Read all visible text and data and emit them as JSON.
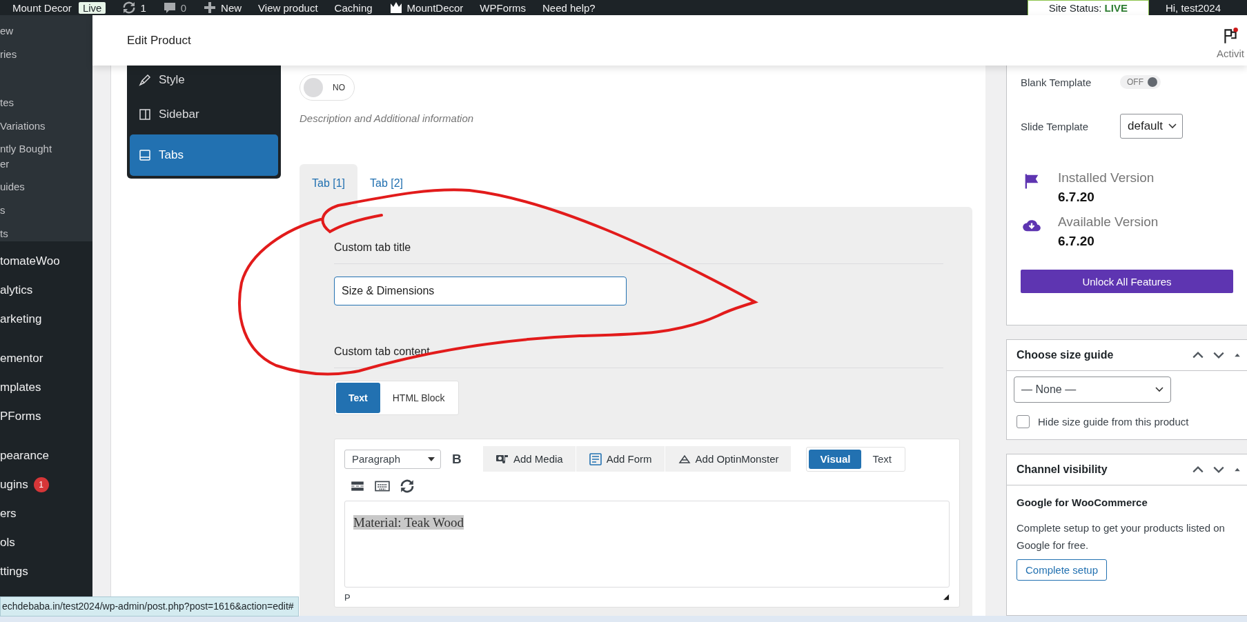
{
  "admin_bar": {
    "items": [
      {
        "kind": "text",
        "label": "Mount Decor"
      },
      {
        "kind": "badge",
        "label": "Live"
      },
      {
        "kind": "updates",
        "label": "1"
      },
      {
        "kind": "comments",
        "label": "0"
      },
      {
        "kind": "new",
        "label": "New"
      },
      {
        "kind": "text",
        "label": "View product"
      },
      {
        "kind": "text",
        "label": "Caching"
      },
      {
        "kind": "logo",
        "label": "MountDecor"
      },
      {
        "kind": "text",
        "label": "WPForms"
      },
      {
        "kind": "text",
        "label": "Need help?"
      }
    ],
    "site_status": {
      "label": "Site Status:",
      "value": "LIVE"
    },
    "greeting": "Hi, test2024"
  },
  "admin_menu": {
    "submenu": [
      {
        "lines": [
          "ew"
        ]
      },
      {
        "lines": [
          "ries"
        ]
      },
      {
        "lines": [
          "tes"
        ]
      },
      {
        "lines": [
          "Variations"
        ]
      },
      {
        "lines": [
          "ntly Bought",
          "er"
        ]
      },
      {
        "lines": [
          "uides"
        ]
      },
      {
        "lines": [
          "s"
        ]
      },
      {
        "lines": [
          "ts"
        ]
      }
    ],
    "items": [
      {
        "label": "tomateWoo"
      },
      {
        "label": "alytics"
      },
      {
        "label": "arketing"
      },
      {
        "label": "ementor"
      },
      {
        "label": "mplates"
      },
      {
        "label": "PForms"
      },
      {
        "label": "pearance"
      },
      {
        "label": "ugins",
        "badge": "1"
      },
      {
        "label": "ers"
      },
      {
        "label": "ols"
      },
      {
        "label": "ttings"
      }
    ]
  },
  "header": {
    "title": "Edit Product",
    "activity_label": "Activit"
  },
  "product_nav": [
    {
      "kind": "style",
      "label": "Style",
      "selected": false
    },
    {
      "kind": "sidebar",
      "label": "Sidebar",
      "selected": false
    },
    {
      "kind": "tabs",
      "label": "Tabs",
      "selected": true
    }
  ],
  "description_toggle": {
    "label": "NO",
    "on": false
  },
  "description_note": "Description and Additional information",
  "tabs": [
    {
      "label": "Tab [1]",
      "selected": true
    },
    {
      "label": "Tab [2]",
      "selected": false
    }
  ],
  "tab_panel": {
    "title_label": "Custom tab title",
    "title_value": "Size & Dimensions",
    "content_label": "Custom tab content",
    "content_modes": [
      {
        "label": "Text",
        "selected": true
      },
      {
        "label": "HTML Block",
        "selected": false
      }
    ],
    "editor": {
      "format": "Paragraph",
      "bold": "B",
      "media_buttons": [
        {
          "kind": "media",
          "label": "Add Media"
        },
        {
          "kind": "form",
          "label": "Add Form"
        },
        {
          "kind": "optin",
          "label": "Add OptinMonster"
        }
      ],
      "view_modes": [
        {
          "label": "Visual",
          "selected": true
        },
        {
          "label": "Text",
          "selected": false
        }
      ],
      "content": "Material: Teak Wood",
      "path": "P"
    }
  },
  "template_panel": {
    "blank_template": {
      "label": "Blank Template",
      "toggle": "OFF",
      "on": false
    },
    "slide_template": {
      "label": "Slide Template",
      "value": "default"
    },
    "versions": [
      {
        "kind": "installed",
        "label": "Installed Version",
        "value": "6.7.20"
      },
      {
        "kind": "available",
        "label": "Available Version",
        "value": "6.7.20"
      }
    ],
    "unlock_button": "Unlock All Features"
  },
  "size_guide": {
    "title": "Choose size guide",
    "select": "— None —",
    "checkbox": {
      "label": "Hide size guide from this product",
      "checked": false
    }
  },
  "channel_visibility": {
    "title": "Channel visibility",
    "heading": "Google for WooCommerce",
    "text": "Complete setup to get your products listed on Google for free.",
    "button": "Complete setup"
  },
  "status_url": "echdebaba.in/test2024/wp-admin/post.php?post=1616&action=edit#"
}
